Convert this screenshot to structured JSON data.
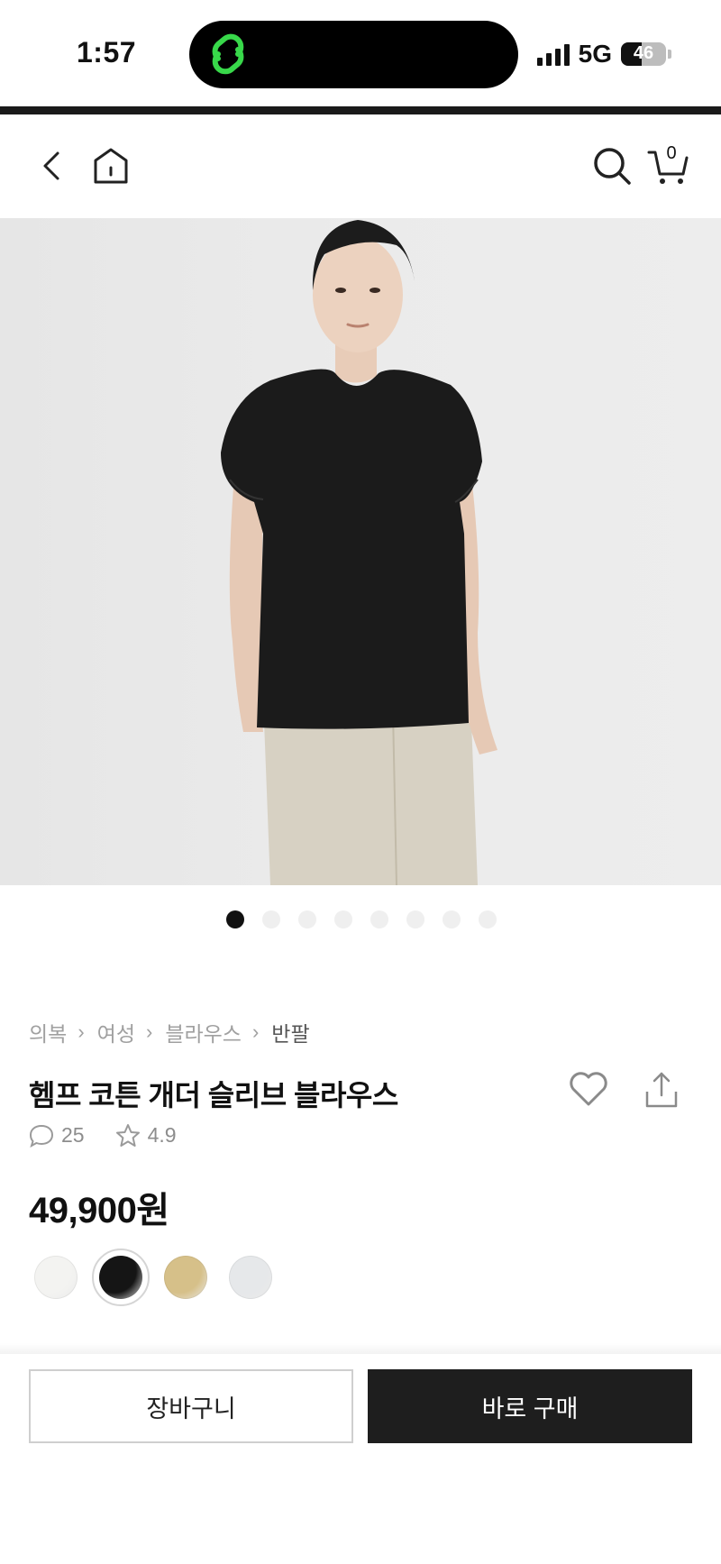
{
  "status_bar": {
    "time": "1:57",
    "network": "5G",
    "battery_level": "46",
    "battery_fraction": 0.46
  },
  "nav": {
    "back_icon": "chevron-left-icon",
    "home_icon": "home-icon",
    "search_icon": "search-icon",
    "cart_icon": "cart-icon",
    "cart_count": "0"
  },
  "gallery": {
    "image_count": 8,
    "active_index": 0
  },
  "breadcrumb": [
    "의복",
    "여성",
    "블라우스",
    "반팔"
  ],
  "product": {
    "title": "헴프 코튼 개더 슬리브 블라우스",
    "review_count": "25",
    "rating": "4.9",
    "price": "49,900원"
  },
  "colors": {
    "swatches": [
      {
        "name": "white",
        "hex": "#f3f3f1"
      },
      {
        "name": "black",
        "hex": "#151515"
      },
      {
        "name": "beige",
        "hex": "#d6c089"
      },
      {
        "name": "light-gray",
        "hex": "#e6e8ea"
      }
    ],
    "selected_index": 1,
    "brand_dark": "#1e1e1e"
  },
  "actions": {
    "cart_label": "장바구니",
    "buy_label": "바로 구매"
  }
}
